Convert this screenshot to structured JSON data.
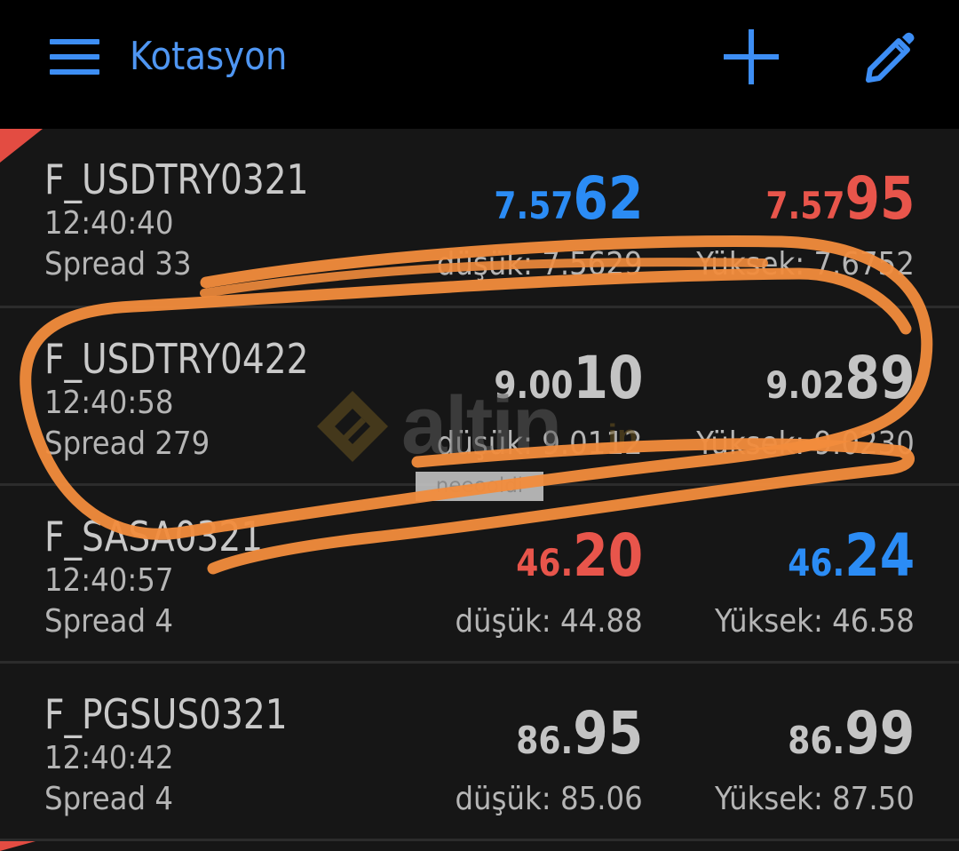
{
  "toolbar": {
    "title": "Kotasyon",
    "menu_icon": "hamburger-menu-icon",
    "add_icon": "plus-icon",
    "edit_icon": "pencil-icon"
  },
  "colors": {
    "accent": "#4f96f2",
    "up": "#2b8cf5",
    "down": "#e8554b",
    "neutral": "#c4c4c4",
    "annotation": "#f28c3c"
  },
  "quotes": [
    {
      "symbol": "F_USDTRY0321",
      "time": "12:40:40",
      "spread": "Spread 33",
      "bid_small": "7.57",
      "bid_big": "62",
      "bid_color": "blue",
      "ask_small": "7.57",
      "ask_big": "95",
      "ask_color": "red",
      "low": "düşük: 7.5629",
      "high": "Yüksek: 7.6752"
    },
    {
      "symbol": "F_USDTRY0422",
      "time": "12:40:58",
      "spread": "Spread 279",
      "bid_small": "9.00",
      "bid_big": "10",
      "bid_color": "gray",
      "ask_small": "9.02",
      "ask_big": "89",
      "ask_color": "gray",
      "low": "düşük: 9.0112",
      "high": "Yüksek: 9.0230"
    },
    {
      "symbol": "F_SASA0321",
      "time": "12:40:57",
      "spread": "Spread 4",
      "bid_small": "46.",
      "bid_big": "20",
      "bid_color": "red",
      "ask_small": "46.",
      "ask_big": "24",
      "ask_color": "blue",
      "low": "düşük: 44.88",
      "high": "Yüksek: 46.58"
    },
    {
      "symbol": "F_PGSUS0321",
      "time": "12:40:42",
      "spread": "Spread 4",
      "bid_small": "86.",
      "bid_big": "95",
      "bid_color": "gray",
      "ask_small": "86.",
      "ask_big": "99",
      "ask_color": "gray",
      "low": "düşük: 85.06",
      "high": "Yüksek: 87.50"
    }
  ],
  "watermark": {
    "brand": "altin",
    "suffix": ".in",
    "user_tag": "neeooldi"
  }
}
